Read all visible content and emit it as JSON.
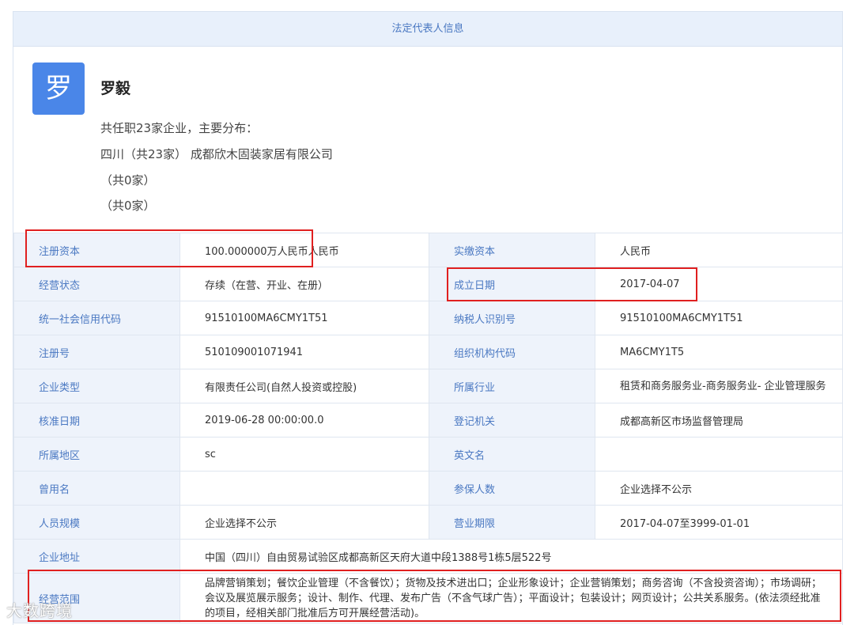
{
  "header": {
    "title": "法定代表人信息"
  },
  "person": {
    "avatar_char": "罗",
    "name": "罗毅",
    "summary": "共任职23家企业，主要分布：",
    "lines": [
      "四川（共23家） 成都欣木固装家居有限公司",
      "（共0家）",
      "（共0家）"
    ]
  },
  "rows": [
    [
      "注册资本",
      "100.000000万人民币人民币",
      "实缴资本",
      "人民币"
    ],
    [
      "经营状态",
      "存续（在营、开业、在册）",
      "成立日期",
      "2017-04-07"
    ],
    [
      "统一社会信用代码",
      "91510100MA6CMY1T51",
      "纳税人识别号",
      "91510100MA6CMY1T51"
    ],
    [
      "注册号",
      "510109001071941",
      "组织机构代码",
      "MA6CMY1T5"
    ],
    [
      "企业类型",
      "有限责任公司(自然人投资或控股)",
      "所属行业",
      "租赁和商务服务业-商务服务业- 企业管理服务"
    ],
    [
      "核准日期",
      "2019-06-28 00:00:00.0",
      "登记机关",
      "成都高新区市场监督管理局"
    ],
    [
      "所属地区",
      "sc",
      "英文名",
      ""
    ],
    [
      "曾用名",
      "",
      "参保人数",
      "企业选择不公示"
    ],
    [
      "人员规模",
      "企业选择不公示",
      "营业期限",
      "2017-04-07至3999-01-01"
    ]
  ],
  "address": {
    "label": "企业地址",
    "value": "中国（四川）自由贸易试验区成都高新区天府大道中段1388号1栋5层522号"
  },
  "scope": {
    "label": "经营范围",
    "value": "品牌营销策划；餐饮企业管理（不含餐饮）；货物及技术进出口；企业形象设计；企业营销策划；商务咨询（不含投资咨询）；市场调研；会议及展览展示服务；设计、制作、代理、发布广告（不含气球广告）；平面设计；包装设计；网页设计；公共关系服务。(依法须经批准的项目，经相关部门批准后方可开展经营活动)。"
  },
  "watermark": "大数跨境"
}
